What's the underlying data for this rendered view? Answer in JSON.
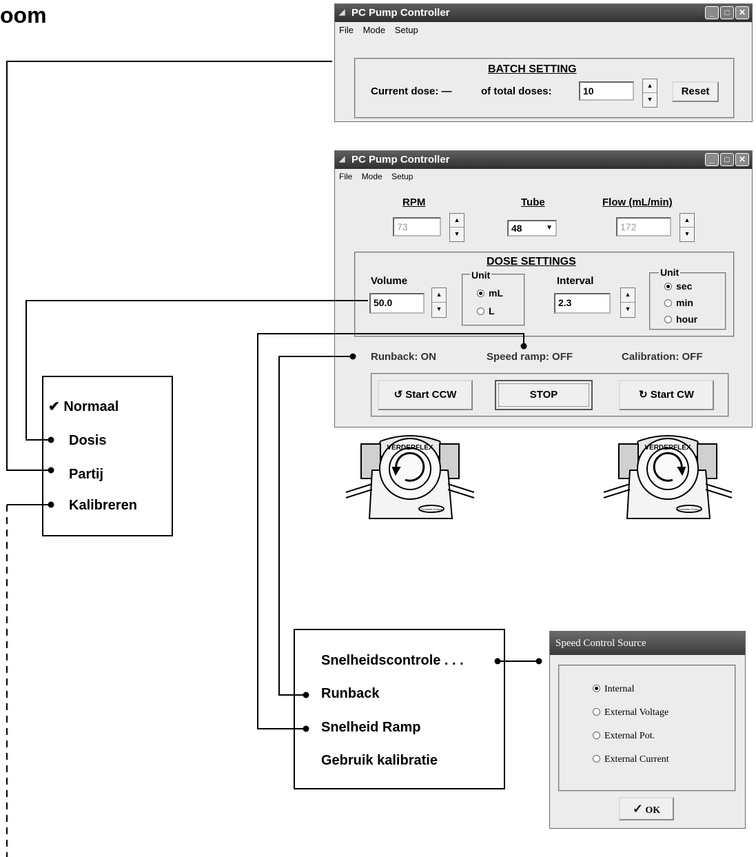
{
  "heading": "oom",
  "batch_window": {
    "title": "PC Pump Controller",
    "menu": [
      "File",
      "Mode",
      "Setup"
    ],
    "group_title": "BATCH SETTING",
    "current_dose_label": "Current dose: —",
    "total_doses_label": "of total doses:",
    "total_doses_value": "10",
    "reset_button": "Reset"
  },
  "dose_window": {
    "title": "PC Pump Controller",
    "menu": [
      "File",
      "Mode",
      "Setup"
    ],
    "rpm_label": "RPM",
    "rpm_value": "73",
    "tube_label": "Tube",
    "tube_value": "48",
    "flow_label": "Flow (mL/min)",
    "flow_value": "172",
    "dose_group_title": "DOSE SETTINGS",
    "volume_label": "Volume",
    "volume_value": "50.0",
    "unit_label": "Unit",
    "unit_options": [
      "mL",
      "L"
    ],
    "unit_selected": "mL",
    "interval_label": "Interval",
    "interval_value": "2.3",
    "interval_unit_label": "Unit",
    "interval_unit_options": [
      "sec",
      "min",
      "hour"
    ],
    "interval_unit_selected": "sec",
    "runback_status": "Runback: ON",
    "speed_ramp_status": "Speed ramp: OFF",
    "calibration_status": "Calibration: OFF",
    "start_ccw": "Start CCW",
    "stop": "STOP",
    "start_cw": "Start CW"
  },
  "pump_label": "VERDERFLEX",
  "pump_plate": "Peristaltic Pumps",
  "mode_menu": {
    "items": [
      "Normaal",
      "Dosis",
      "Partij",
      "Kalibreren"
    ],
    "checked": "Normaal"
  },
  "setup_menu": {
    "items": [
      "Snelheidscontrole . . .",
      "Runback",
      "Snelheid Ramp",
      "Gebruik kalibratie"
    ]
  },
  "speed_dialog": {
    "title": "Speed Control Source",
    "options": [
      "Internal",
      "External Voltage",
      "External Pot.",
      "External Current"
    ],
    "selected": "Internal",
    "ok": "OK"
  }
}
